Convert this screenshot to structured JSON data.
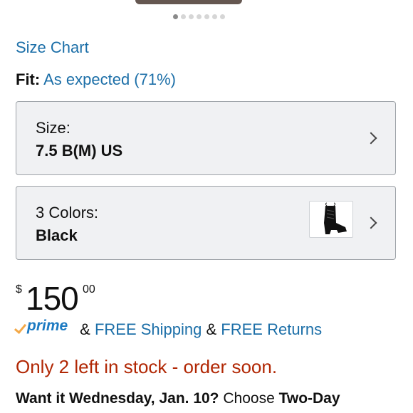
{
  "carousel": {
    "count": 7,
    "active_index": 0
  },
  "links": {
    "size_chart": "Size Chart"
  },
  "fit": {
    "label": "Fit:",
    "value": "As expected (71%)"
  },
  "size_selector": {
    "label": "Size:",
    "value": "7.5 B(M) US",
    "icon": "chevron-right-icon"
  },
  "color_selector": {
    "label": "3 Colors:",
    "value": "Black",
    "thumbnail": "black-lace-up-bootie-image",
    "icon": "chevron-right-icon"
  },
  "price": {
    "currency": "$",
    "whole": "150",
    "fraction": "00"
  },
  "shipping": {
    "prime_label": "prime",
    "amp": "&",
    "free_shipping": "FREE Shipping",
    "free_returns": "FREE Returns"
  },
  "stock": {
    "message": "Only 2 left in stock - order soon."
  },
  "delivery": {
    "prefix": "Want it Wednesday, Jan. 10?",
    "middle": "Choose",
    "option": "Two-Day"
  },
  "colors": {
    "link": "#1c6fa8",
    "stock": "#b12704",
    "prime_blue": "#1c7ac2",
    "prime_orange": "#f3a847",
    "selector_bg": "#f0f1f3"
  }
}
